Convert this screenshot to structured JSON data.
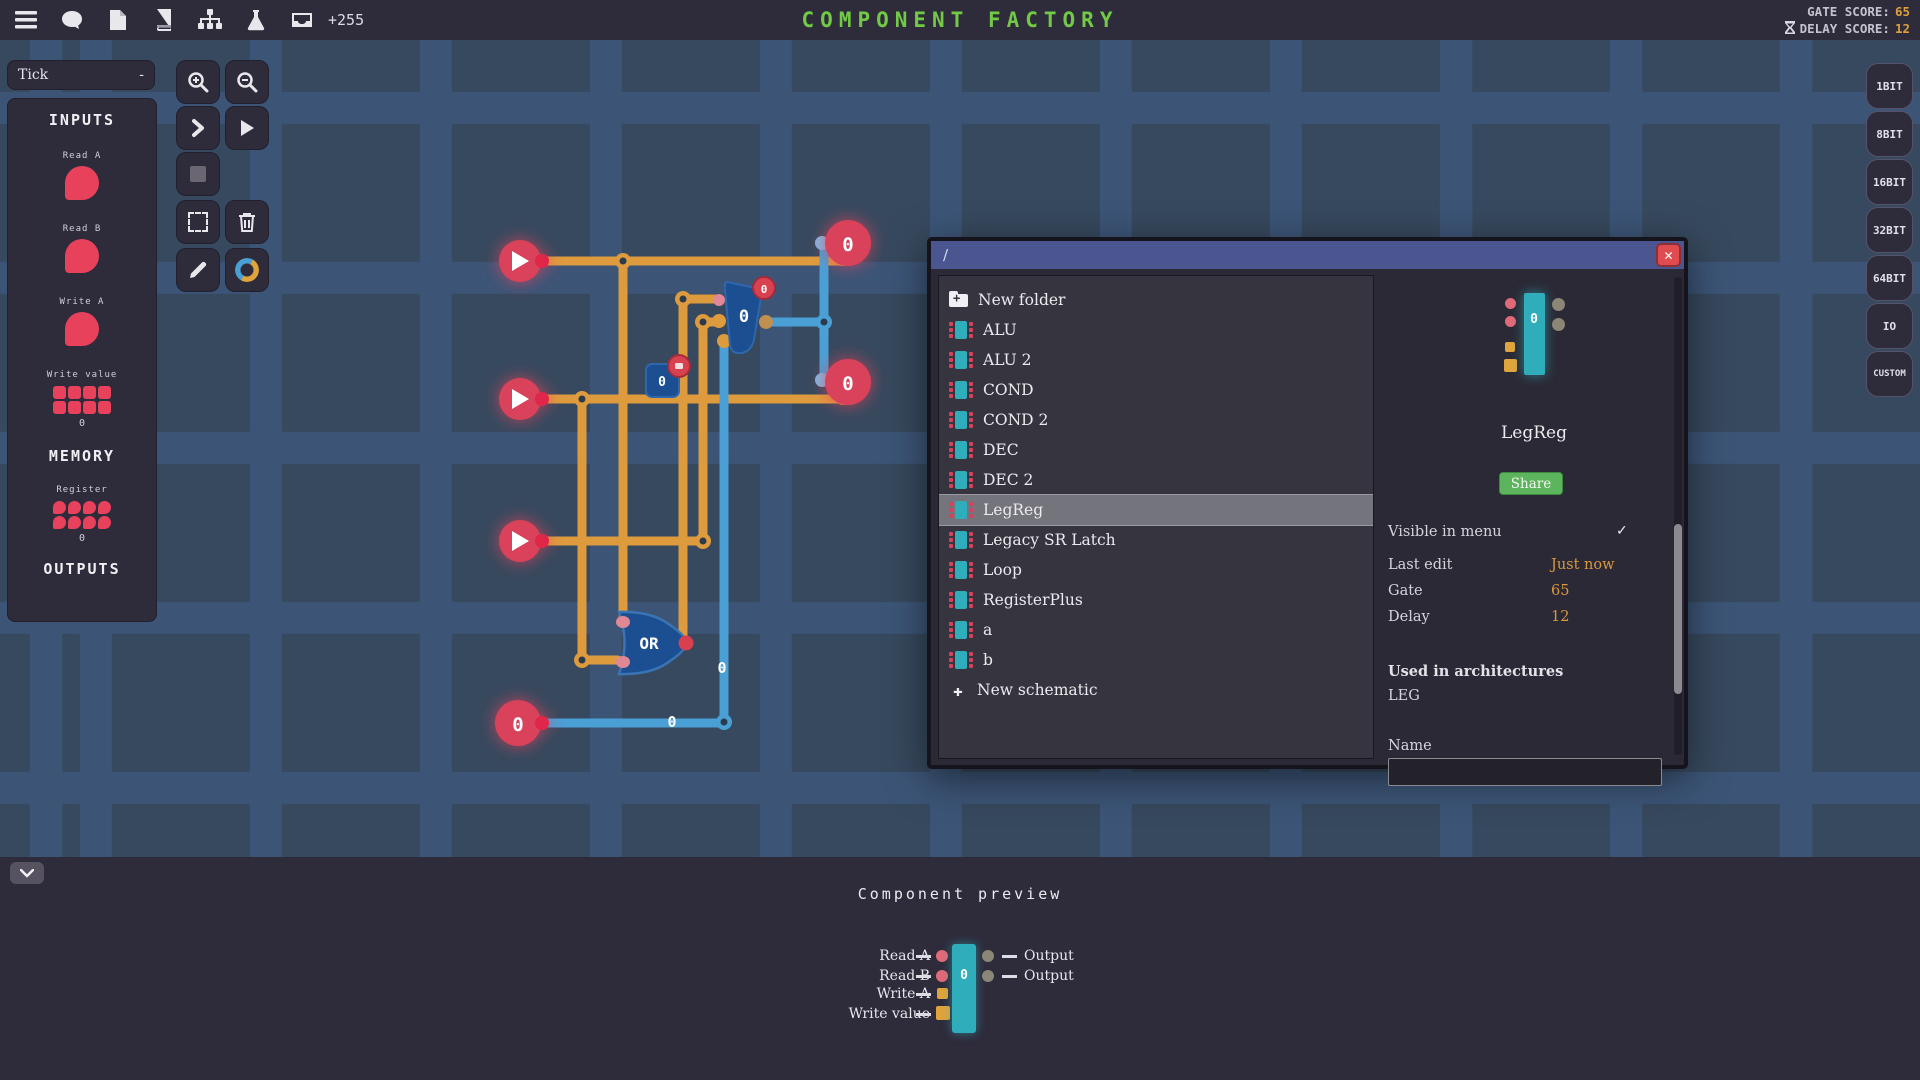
{
  "top_bar": {
    "icons": [
      "menu",
      "chat",
      "file",
      "book",
      "hierarchy",
      "flask",
      "tray"
    ],
    "tray_count": "+255",
    "title": "COMPONENT FACTORY",
    "gate_score_label": "GATE SCORE:",
    "gate_score_value": "65",
    "delay_score_label": "DELAY SCORE:",
    "delay_score_value": "12"
  },
  "left_panel": {
    "tick_label": "Tick",
    "tick_collapse": "-",
    "inputs_header": "INPUTS",
    "read_a_label": "Read A",
    "read_b_label": "Read B",
    "write_a_label": "Write A",
    "write_value_label": "Write value",
    "write_value_value": "0",
    "memory_header": "MEMORY",
    "register_label": "Register",
    "register_value": "0",
    "outputs_header": "OUTPUTS"
  },
  "toolbar_icons": [
    "zoom-in",
    "zoom-out",
    "step",
    "play",
    "stop",
    "box-select",
    "delete",
    "edit",
    "hue-ring"
  ],
  "bit_buttons": [
    "1BIT",
    "8BIT",
    "16BIT",
    "32BIT",
    "64BIT",
    "IO",
    "CUSTOM"
  ],
  "dialog": {
    "path": "/",
    "items": [
      {
        "icon": "new-folder",
        "label": "New folder"
      },
      {
        "icon": "component",
        "label": "ALU"
      },
      {
        "icon": "component",
        "label": "ALU 2"
      },
      {
        "icon": "component",
        "label": "COND"
      },
      {
        "icon": "component",
        "label": "COND 2"
      },
      {
        "icon": "component",
        "label": "DEC"
      },
      {
        "icon": "component",
        "label": "DEC 2"
      },
      {
        "icon": "component",
        "label": "LegReg",
        "selected": true
      },
      {
        "icon": "component",
        "label": "Legacy SR Latch"
      },
      {
        "icon": "component",
        "label": "Loop"
      },
      {
        "icon": "component",
        "label": "RegisterPlus"
      },
      {
        "icon": "component",
        "label": "a"
      },
      {
        "icon": "component",
        "label": "b"
      },
      {
        "icon": "plus",
        "label": "New schematic"
      }
    ],
    "details": {
      "icon_value": "0",
      "name": "LegReg",
      "share_label": "Share",
      "visible_label": "Visible in menu",
      "visible_check": "✓",
      "last_edit_label": "Last edit",
      "last_edit_value": "Just now",
      "gate_label": "Gate",
      "gate_value": "65",
      "delay_label": "Delay",
      "delay_value": "12",
      "used_in_header": "Used in architectures",
      "used_in_value": "LEG",
      "name_label": "Name",
      "name_input_value": ""
    }
  },
  "canvas": {
    "or_label": "OR",
    "flag_value": "0",
    "flag_badge": "0",
    "box_value": "0",
    "out1_value": "0",
    "out2_value": "0",
    "out3_value": "0",
    "wire_label_v": "0",
    "wire_label_h": "0"
  },
  "bottom_panel": {
    "title": "Component preview",
    "preview_value": "0",
    "left_pins": [
      {
        "label": "Read A"
      },
      {
        "label": "Read B"
      },
      {
        "label": "Write A"
      },
      {
        "label": "Write value"
      }
    ],
    "right_pins": [
      {
        "label": "Output"
      },
      {
        "label": "Output"
      }
    ]
  },
  "colors": {
    "accent_teal": "#2fadbb",
    "accent_orange": "#dd9b3e",
    "accent_blue": "#4aa0d5",
    "accent_red": "#d9435a",
    "title_green": "#72c945",
    "score_orange": "#dea03e",
    "share_green": "#5cb55c"
  }
}
